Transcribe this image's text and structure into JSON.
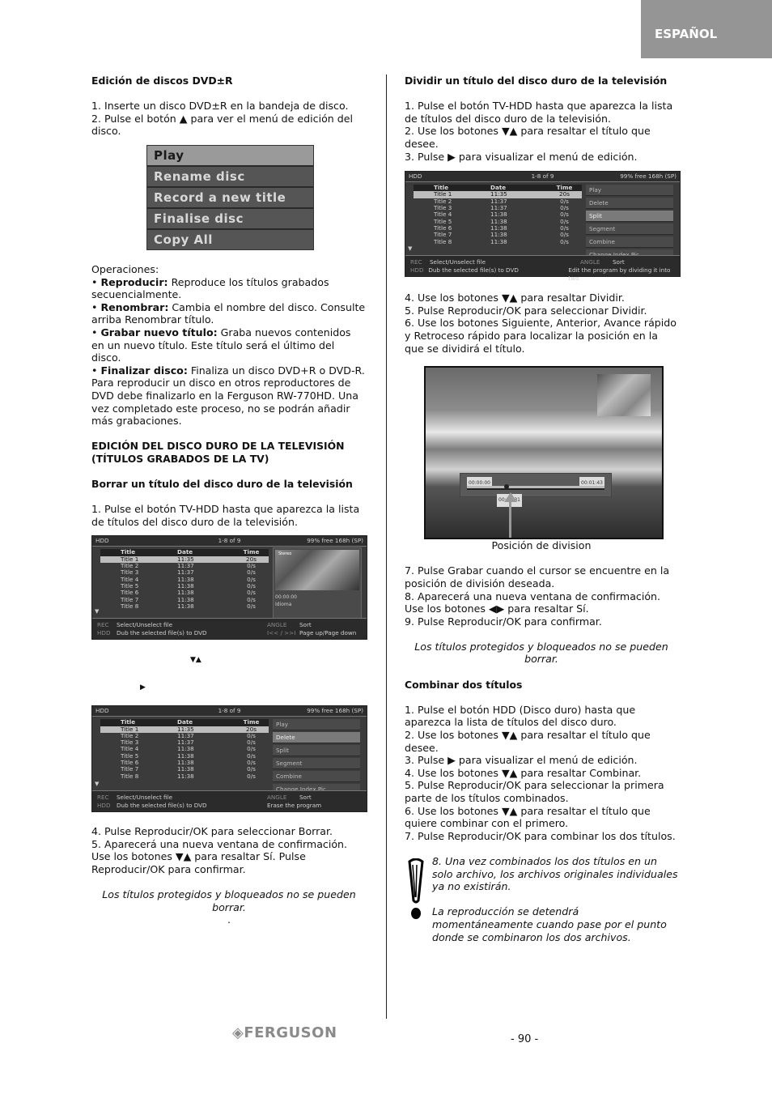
{
  "header": {
    "language_tab": "ESPAÑOL"
  },
  "left": {
    "section1_title": "Edición de discos DVD±R",
    "steps1": [
      "1. Inserte un disco DVD±R en la bandeja de disco.",
      "2. Pulse el botón ▲ para ver el menú de edición del disco."
    ],
    "dvd_menu": {
      "items": [
        "Play",
        "Rename disc",
        "Record a new title",
        "Finalise disc",
        "Copy All"
      ],
      "selected_index": 0
    },
    "operations_label": "Operaciones:",
    "operations": [
      {
        "term": "Reproducir:",
        "desc": " Reproduce los títulos grabados secuencialmente."
      },
      {
        "term": "Renombrar:",
        "desc": " Cambia el nombre del disco. Consulte arriba Renombrar título."
      },
      {
        "term": "Grabar nuevo título:",
        "desc": " Graba nuevos contenidos en un nuevo título. Este título será el último del disco."
      },
      {
        "term": "Finalizar disco:",
        "desc": " Finaliza un disco DVD+R o DVD-R. Para reproducir un disco en otros reproductores de DVD debe finalizarlo en la Ferguson RW-770HD. Una vez completado este proceso, no se podrán añadir más grabaciones."
      }
    ],
    "section2_title": "EDICIÓN DEL DISCO DURO DE LA TELEVISIÓN (TÍTULOS GRABADOS DE LA TV)",
    "section3_title": "Borrar un título del disco duro de la televisión",
    "steps3a": "1. Pulse el botón TV-HDD hasta que aparezca la lista de títulos del disco duro de la televisión.",
    "arrows_updown": "▼▲",
    "arrow_right": "▶",
    "steps3b": [
      "4. Pulse Reproducir/OK para seleccionar Borrar.",
      "5. Aparecerá una nueva ventana de confirmación. Use los botones ▼▲ para resaltar Sí. Pulse Reproducir/OK para confirmar."
    ],
    "note": "Los títulos protegidos y bloqueados no se pueden borrar.",
    "dot": "."
  },
  "hdd_common": {
    "device": "HDD",
    "range": "1-8  of 9",
    "free": "99% free 168h (SP)",
    "columns": [
      "Title",
      "Date",
      "Time"
    ],
    "rows": [
      [
        "Title 1",
        "11:35",
        "20s"
      ],
      [
        "Title 2",
        "11:37",
        "0/s"
      ],
      [
        "Title 3",
        "11:37",
        "0/s"
      ],
      [
        "Title 4",
        "11:38",
        "0/s"
      ],
      [
        "Title 5",
        "11:38",
        "0/s"
      ],
      [
        "Title 6",
        "11:38",
        "0/s"
      ],
      [
        "Title 7",
        "11:38",
        "0/s"
      ],
      [
        "Title 8",
        "11:38",
        "0/s"
      ]
    ],
    "selected_row": 0,
    "footer_rec": "REC",
    "footer_hdd": "HDD",
    "footer_select": "Select/Unselect file",
    "footer_dub": "Dub the selected file(s) to DVD",
    "footer_angle": "ANGLE",
    "footer_sort": "Sort"
  },
  "hdd_screen1": {
    "key2": "I<< / >>I",
    "action2": "Page up/Page down",
    "preview_label": "Stereo",
    "preview_info": [
      "00:00:00",
      "Idioma"
    ]
  },
  "hdd_screen2": {
    "menu": [
      "Play",
      "Delete",
      "Split",
      "Segment",
      "Combine",
      "Change Index Pic"
    ],
    "selected": 1,
    "action2": "Erase the program"
  },
  "hdd_screen3": {
    "menu": [
      "Play",
      "Delete",
      "Split",
      "Segment",
      "Combine",
      "Change Index Pic"
    ],
    "selected": 2,
    "action2": "Edit the program by dividing it into two"
  },
  "right": {
    "section_title": "Dividir un título del disco duro de la televisión",
    "steps_a": [
      "1. Pulse el botón TV-HDD hasta que aparezca la lista de títulos del disco duro de la televisión.",
      "2. Use los botones ▼▲ para resaltar el título que desee.",
      "3. Pulse ▶ para visualizar el menú de edición."
    ],
    "steps_b": [
      "4. Use los botones ▼▲ para resaltar Dividir.",
      "5. Pulse Reproducir/OK para seleccionar Dividir.",
      "6. Use los botones Siguiente, Anterior, Avance rápido y Retroceso rápido para localizar la posición en la que se dividirá el título."
    ],
    "split_image": {
      "start_time": "00:00:00",
      "end_time": "00:01:43",
      "cursor_time": "00:00:31",
      "caption": "Posición de division"
    },
    "steps_c": [
      "7. Pulse Grabar cuando el cursor se encuentre en la posición de división deseada.",
      "8. Aparecerá una nueva ventana de confirmación. Use los botones ◀▶ para resaltar Sí.",
      "9. Pulse Reproducir/OK para confirmar."
    ],
    "note": "Los títulos protegidos y bloqueados no se pueden borrar.",
    "combine_title": "Combinar dos títulos",
    "combine_steps": [
      "1. Pulse el botón HDD (Disco duro) hasta que aparezca la lista de títulos del disco duro.",
      "2. Use los botones ▼▲ para resaltar el título que desee.",
      "3. Pulse ▶ para visualizar el menú de edición.",
      "4. Use los botones ▼▲ para resaltar Combinar.",
      "5. Pulse Reproducir/OK para seleccionar la primera parte de los títulos combinados.",
      "6. Use los botones ▼▲ para resaltar el título que quiere combinar con el primero.",
      "7. Pulse Reproducir/OK para combinar los dos títulos."
    ],
    "warning_1": "8. Una vez combinados los dos títulos en un solo archivo, los archivos originales individuales ya no existirán.",
    "warning_2": "La reproducción se detendrá momentáneamente cuando pase por el punto donde se combinaron los dos archivos."
  },
  "footer": {
    "brand": "FERGUSON",
    "page": "- 90 -"
  }
}
